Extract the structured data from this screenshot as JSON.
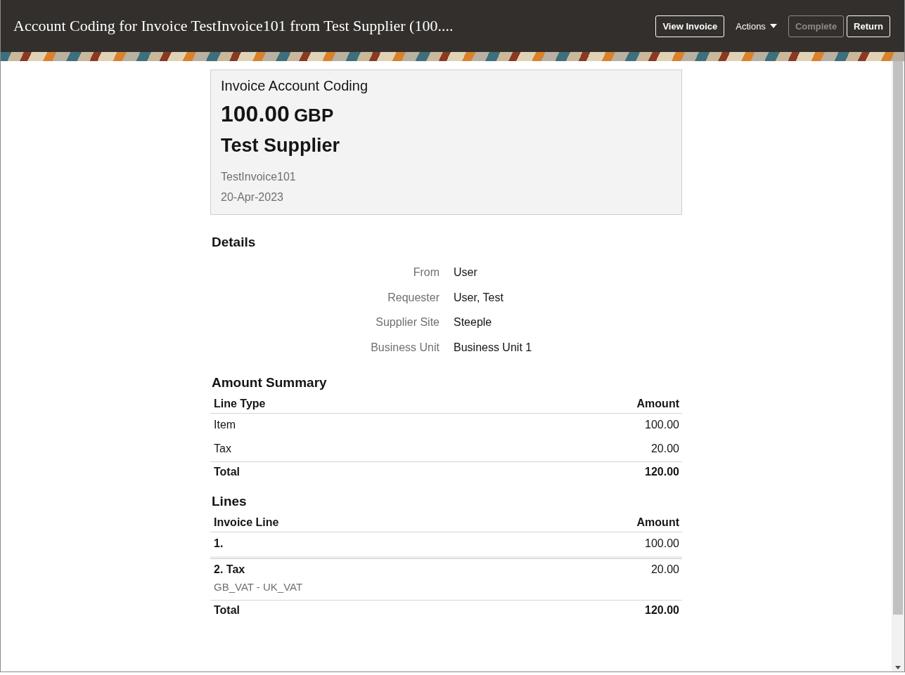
{
  "window": {
    "title": "Account Coding for Invoice TestInvoice101 from Test Supplier (100...."
  },
  "header_buttons": [
    {
      "label": "View Invoice",
      "kind": "button",
      "disabled": false
    },
    {
      "label": "Actions",
      "kind": "menu",
      "disabled": false
    },
    {
      "label": "Complete",
      "kind": "button",
      "disabled": true
    },
    {
      "label": "Return",
      "kind": "button",
      "disabled": false
    }
  ],
  "summary": {
    "title": "Invoice Account Coding",
    "amount": "100.00",
    "currency": "GBP",
    "supplier": "Test Supplier",
    "invoice_number": "TestInvoice101",
    "date": "20-Apr-2023"
  },
  "details": {
    "title": "Details",
    "fields": [
      {
        "label": "From",
        "value": "User"
      },
      {
        "label": "Requester",
        "value": "User, Test"
      },
      {
        "label": "Supplier Site",
        "value": "Steeple"
      },
      {
        "label": "Business Unit",
        "value": "Business Unit 1"
      }
    ]
  },
  "amount_summary": {
    "title": "Amount Summary",
    "columns": [
      "Line Type",
      "Amount"
    ],
    "rows": [
      {
        "line_type": "Item",
        "amount": "100.00"
      },
      {
        "line_type": "Tax",
        "amount": "20.00"
      }
    ],
    "total": {
      "label": "Total",
      "amount": "120.00"
    }
  },
  "lines": {
    "title": "Lines",
    "columns": [
      "Invoice Line",
      "Amount"
    ],
    "rows": [
      {
        "line": "1.",
        "amount": "100.00"
      },
      {
        "line": "2. Tax",
        "description": "GB_VAT - UK_VAT",
        "amount": "20.00"
      }
    ],
    "total": {
      "label": "Total",
      "amount": "120.00"
    }
  }
}
